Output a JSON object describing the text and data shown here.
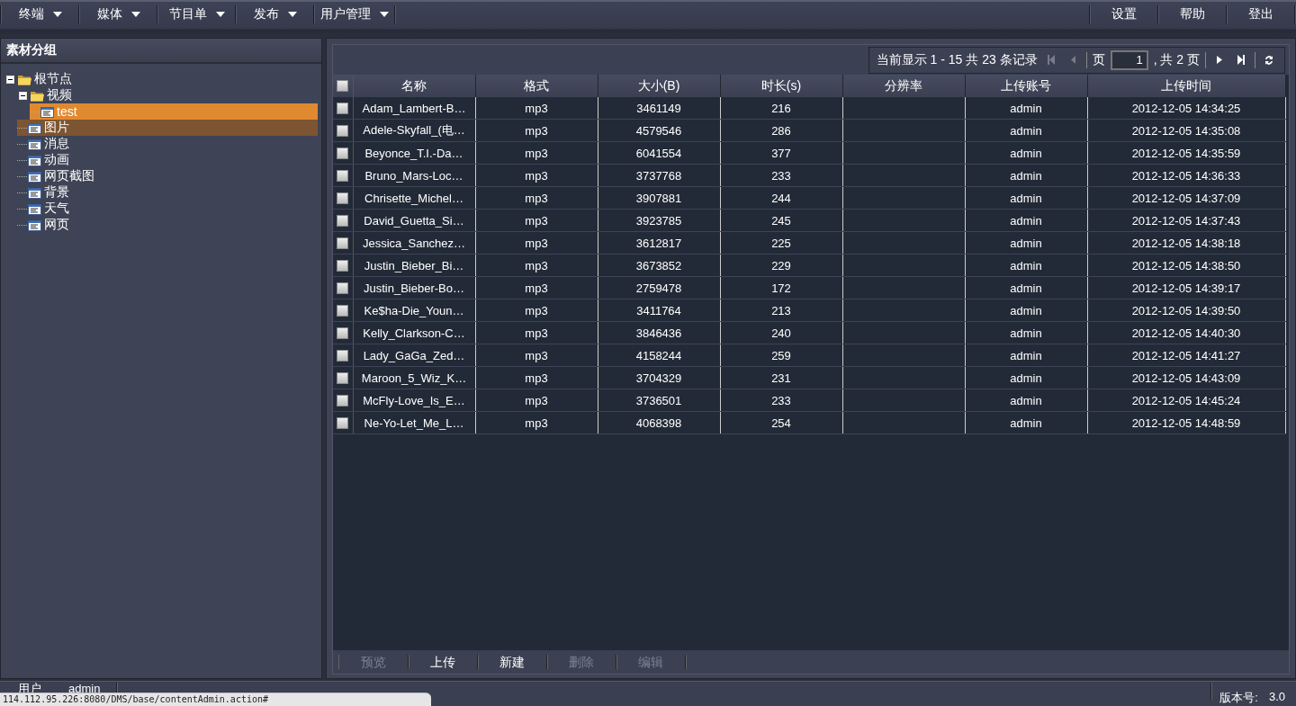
{
  "menubar": {
    "left": [
      {
        "label": "终端"
      },
      {
        "label": "媒体"
      },
      {
        "label": "节目单"
      },
      {
        "label": "发布"
      },
      {
        "label": "用户管理"
      }
    ],
    "right": [
      {
        "label": "设置"
      },
      {
        "label": "帮助"
      },
      {
        "label": "登出"
      }
    ]
  },
  "sidebar": {
    "title": "素材分组",
    "tree": [
      {
        "label": "根节点",
        "kind": "folder",
        "expanded": true,
        "selected": false,
        "highlighted": false,
        "children": [
          {
            "label": "视频",
            "kind": "folder",
            "expanded": true,
            "selected": false,
            "highlighted": false,
            "children": [
              {
                "label": "test",
                "kind": "file",
                "selected": true,
                "highlighted": false
              }
            ]
          },
          {
            "label": "图片",
            "kind": "file",
            "selected": false,
            "highlighted": true
          },
          {
            "label": "消息",
            "kind": "file",
            "selected": false,
            "highlighted": false
          },
          {
            "label": "动画",
            "kind": "file",
            "selected": false,
            "highlighted": false
          },
          {
            "label": "网页截图",
            "kind": "file",
            "selected": false,
            "highlighted": false
          },
          {
            "label": "背景",
            "kind": "file",
            "selected": false,
            "highlighted": false
          },
          {
            "label": "天气",
            "kind": "file",
            "selected": false,
            "highlighted": false
          },
          {
            "label": "网页",
            "kind": "file",
            "selected": false,
            "highlighted": false
          }
        ]
      }
    ]
  },
  "pager": {
    "summary": "当前显示 1 - 15 共 23 条记录",
    "page_label": "页",
    "page": "1",
    "total": ", 共 2 页",
    "first_disabled": true,
    "prev_disabled": true
  },
  "table": {
    "select_all": {
      "checked": false
    },
    "columns": [
      "名称",
      "格式",
      "大小(B)",
      "时长(s)",
      "分辨率",
      "上传账号",
      "上传时间"
    ],
    "rows": [
      {
        "checked": false,
        "cells": [
          "Adam_Lambert-B…",
          "mp3",
          "3461149",
          "216",
          "",
          "admin",
          "2012-12-05 14:34:25"
        ]
      },
      {
        "checked": false,
        "cells": [
          "Adele-Skyfall_(电…",
          "mp3",
          "4579546",
          "286",
          "",
          "admin",
          "2012-12-05 14:35:08"
        ]
      },
      {
        "checked": false,
        "cells": [
          "Beyonce_T.I.-Da…",
          "mp3",
          "6041554",
          "377",
          "",
          "admin",
          "2012-12-05 14:35:59"
        ]
      },
      {
        "checked": false,
        "cells": [
          "Bruno_Mars-Loc…",
          "mp3",
          "3737768",
          "233",
          "",
          "admin",
          "2012-12-05 14:36:33"
        ]
      },
      {
        "checked": false,
        "cells": [
          "Chrisette_Michel…",
          "mp3",
          "3907881",
          "244",
          "",
          "admin",
          "2012-12-05 14:37:09"
        ]
      },
      {
        "checked": false,
        "cells": [
          "David_Guetta_Si…",
          "mp3",
          "3923785",
          "245",
          "",
          "admin",
          "2012-12-05 14:37:43"
        ]
      },
      {
        "checked": false,
        "cells": [
          "Jessica_Sanchez…",
          "mp3",
          "3612817",
          "225",
          "",
          "admin",
          "2012-12-05 14:38:18"
        ]
      },
      {
        "checked": false,
        "cells": [
          "Justin_Bieber_Bi…",
          "mp3",
          "3673852",
          "229",
          "",
          "admin",
          "2012-12-05 14:38:50"
        ]
      },
      {
        "checked": false,
        "cells": [
          "Justin_Bieber-Bo…",
          "mp3",
          "2759478",
          "172",
          "",
          "admin",
          "2012-12-05 14:39:17"
        ]
      },
      {
        "checked": false,
        "cells": [
          "Ke$ha-Die_Youn…",
          "mp3",
          "3411764",
          "213",
          "",
          "admin",
          "2012-12-05 14:39:50"
        ]
      },
      {
        "checked": false,
        "cells": [
          "Kelly_Clarkson-C…",
          "mp3",
          "3846436",
          "240",
          "",
          "admin",
          "2012-12-05 14:40:30"
        ]
      },
      {
        "checked": false,
        "cells": [
          "Lady_GaGa_Zed…",
          "mp3",
          "4158244",
          "259",
          "",
          "admin",
          "2012-12-05 14:41:27"
        ]
      },
      {
        "checked": false,
        "cells": [
          "Maroon_5_Wiz_K…",
          "mp3",
          "3704329",
          "231",
          "",
          "admin",
          "2012-12-05 14:43:09"
        ]
      },
      {
        "checked": false,
        "cells": [
          "McFly-Love_Is_E…",
          "mp3",
          "3736501",
          "233",
          "",
          "admin",
          "2012-12-05 14:45:24"
        ]
      },
      {
        "checked": false,
        "cells": [
          "Ne-Yo-Let_Me_L…",
          "mp3",
          "4068398",
          "254",
          "",
          "admin",
          "2012-12-05 14:48:59"
        ]
      }
    ]
  },
  "actions": [
    {
      "label": "预览",
      "disabled": true
    },
    {
      "label": "上传",
      "disabled": false
    },
    {
      "label": "新建",
      "disabled": false
    },
    {
      "label": "删除",
      "disabled": true
    },
    {
      "label": "编辑",
      "disabled": true
    }
  ],
  "status_bar": {
    "user_label": "用户",
    "user": "admin",
    "version_label": "版本号:",
    "version": "3.0"
  },
  "browser_status": {
    "url": "114.112.95.226:8080/DMS/base/contentAdmin.action#"
  }
}
